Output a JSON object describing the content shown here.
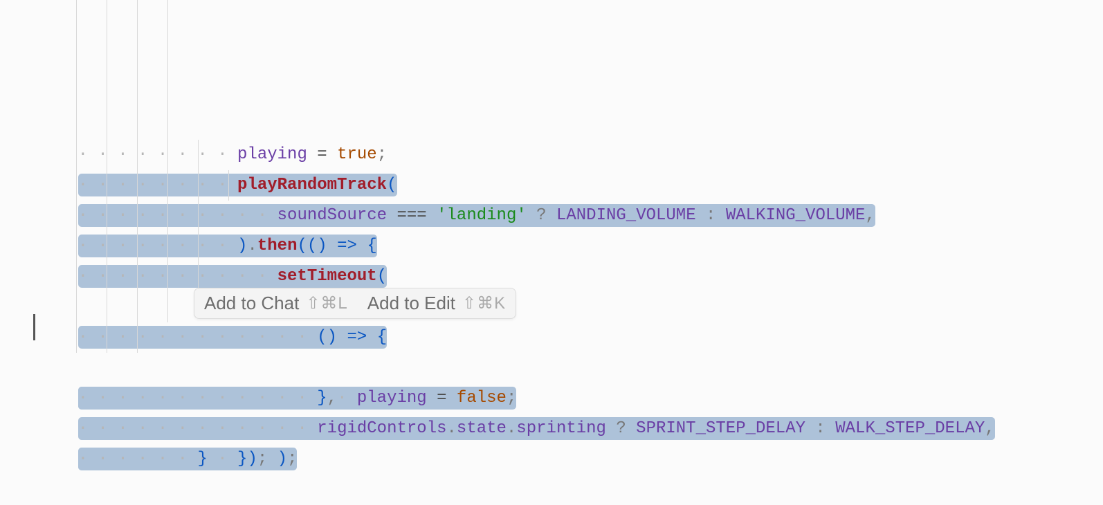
{
  "code": {
    "line1": {
      "var": "playing",
      "op": "=",
      "val": "true",
      "semi": ";"
    },
    "line2": {
      "fn": "playRandomTrack",
      "paren": "("
    },
    "line3": {
      "var": "soundSource",
      "eqeq": "===",
      "str": "'landing'",
      "q": "?",
      "c1": "LANDING_VOLUME",
      "colon": ":",
      "c2": "WALKING_VOLUME",
      "comma": ","
    },
    "line4": {
      "close": ")",
      "dot": ".",
      "then": "then",
      "paren": "(",
      "paren2": "(",
      "paren3": ")",
      "arrow": "=>",
      "curly": "{"
    },
    "line5": {
      "fn": "setTimeout",
      "paren": "("
    },
    "line6": {
      "paren": "(",
      "paren2": ")",
      "arrow": "=>",
      "curly": "{"
    },
    "line7": {
      "var": "playing",
      "op": "=",
      "val": "false",
      "semi": ";"
    },
    "line8": {
      "curly": "}",
      "comma": ","
    },
    "line9": {
      "var": "rigidControls",
      "dot1": ".",
      "prop1": "state",
      "dot2": ".",
      "prop2": "sprinting",
      "q": "?",
      "c1": "SPRINT_STEP_DELAY",
      "colon": ":",
      "c2": "WALK_STEP_DELAY",
      "comma": ","
    },
    "line10": {
      "paren": ")",
      "semi": ";"
    },
    "line11": {
      "curly": "}",
      "paren": ")",
      "semi": ";"
    },
    "line12": {
      "curly": "}"
    }
  },
  "popup": {
    "addChat": "Add to Chat",
    "addChatKey": "⇧⌘L",
    "addEdit": "Add to Edit",
    "addEditKey": "⇧⌘K"
  }
}
